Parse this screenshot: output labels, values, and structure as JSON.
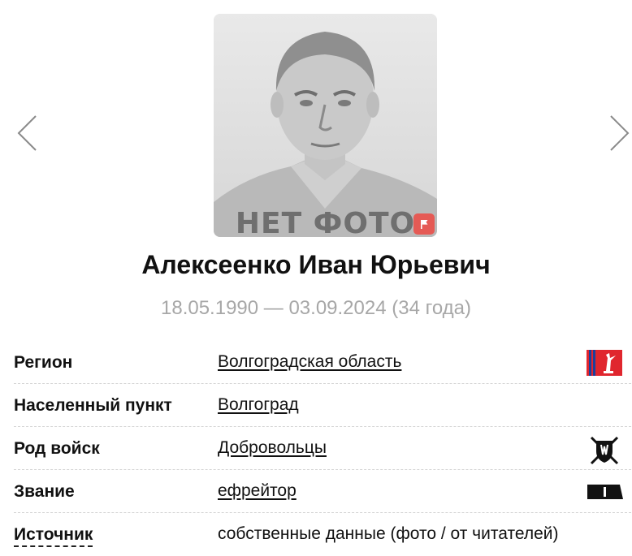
{
  "photo": {
    "placeholder_text": "НЕТ ФОТО",
    "report_icon": "flag-icon",
    "report_color": "#e55a55"
  },
  "nav": {
    "prev_icon": "chevron-left-icon",
    "next_icon": "chevron-right-icon"
  },
  "person": {
    "name": "Алексеенко Иван Юрьевич",
    "dates": "18.05.1990 — 03.09.2024 (34 года)"
  },
  "info": {
    "region": {
      "label": "Регион",
      "value": "Волгоградская область",
      "icon": "region-emblem-icon"
    },
    "locality": {
      "label": "Населенный пункт",
      "value": "Волгоград"
    },
    "branch": {
      "label": "Род войск",
      "value": "Добровольцы",
      "icon": "shield-swords-icon"
    },
    "rank": {
      "label": "Звание",
      "value": "ефрейтор",
      "icon": "rank-insignia-icon"
    },
    "source": {
      "label": "Источник",
      "value": "собственные данные (фото / от читателей)"
    }
  },
  "colors": {
    "dates_text": "#a7a7a7",
    "region_emblem_red": "#e0262e"
  }
}
